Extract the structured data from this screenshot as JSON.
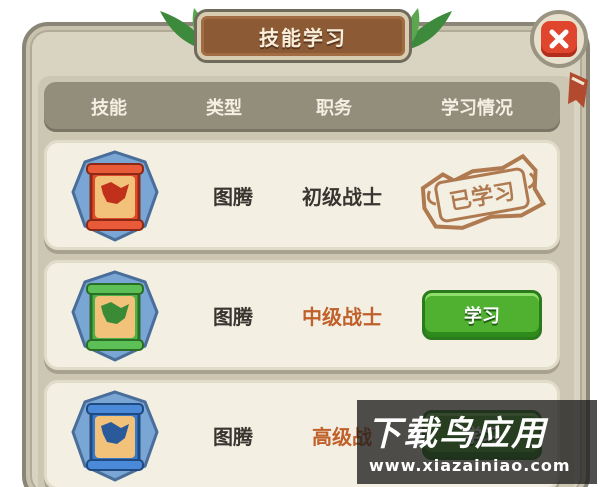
{
  "dialog": {
    "title": "技能学习"
  },
  "header": {
    "col_skill": "技能",
    "col_type": "类型",
    "col_rank": "职务",
    "col_status": "学习情况"
  },
  "skills": [
    {
      "type": "图腾",
      "rank": "初级战士",
      "rank_color": "#3a3530",
      "status": "learned",
      "status_label": "已学习",
      "totem_color": "#e04a2b",
      "totem_icon": "red-wolf-totem-icon"
    },
    {
      "type": "图腾",
      "rank": "中级战士",
      "rank_color": "#c0602a",
      "status": "learnable",
      "status_label": "学习",
      "totem_color": "#4fb04a",
      "totem_icon": "green-wolf-totem-icon"
    },
    {
      "type": "图腾",
      "rank": "高级战",
      "rank_color": "#c0602a",
      "status": "learnable",
      "status_label": "学习",
      "totem_color": "#3a78c8",
      "totem_icon": "blue-wolf-totem-icon"
    }
  ],
  "watermark": {
    "title": "下载鸟应用",
    "url": "www.xiazainiao.com"
  },
  "colors": {
    "panel_bg": "#d9d3c2",
    "header_bg": "#938d7c",
    "title_plate": "#8c5a35",
    "learn_button": "#4fb12f",
    "close_button": "#e0452e"
  }
}
